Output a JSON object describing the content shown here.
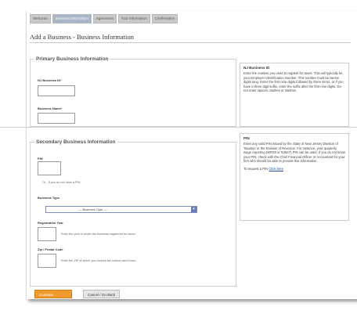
{
  "tabs": [
    "Welcome",
    "Business Information",
    "Agreement",
    "Your Information",
    "Confirmation"
  ],
  "page": {
    "title": "Add a Business - Business Information"
  },
  "primary": {
    "legend": "Primary Business Information",
    "nj_id_label": "NJ Business ID*",
    "name_label": "Business Name*"
  },
  "secondary": {
    "legend": "Secondary Business Information",
    "pin_label": "PIN",
    "pin_note": "Or - If you do not have a PIN",
    "type_label": "Business Type",
    "type_value": "---- Business Type ----",
    "year_label": "Registration Year",
    "year_note": "Enter the year in which the business registered for taxes.",
    "zip_label": "Zip / Postal Code",
    "zip_note": "Enter the ZIP at which you receive tax notices and forms."
  },
  "help_nj": {
    "heading": "NJ Business ID",
    "text": "Enter the number you used to register for taxes. This will typically be your Employer Identification Number. This number must be twelve digits long. Enter the first nine digits followed by three zeros, or if you have a three digit suffix, enter the suffix after the first nine digits. Do not enter spaces, dashes or slashes."
  },
  "help_pin": {
    "heading": "PIN",
    "text": "Enter any valid PIN issued by the State of New Jersey Division of Taxation or the Division of Revenue. For instance, your quarterly wage reporting (WR30 or NJ927) PIN can be used. If you do not know your PIN, check with the Chief Financial Officer or Accountant for your firm who should be able to provide this information.",
    "request_prefix": "To request a PIN",
    "request_link": "Click here"
  },
  "buttons": {
    "continue": "Continue",
    "cancel": "Cancel / Go Back"
  }
}
